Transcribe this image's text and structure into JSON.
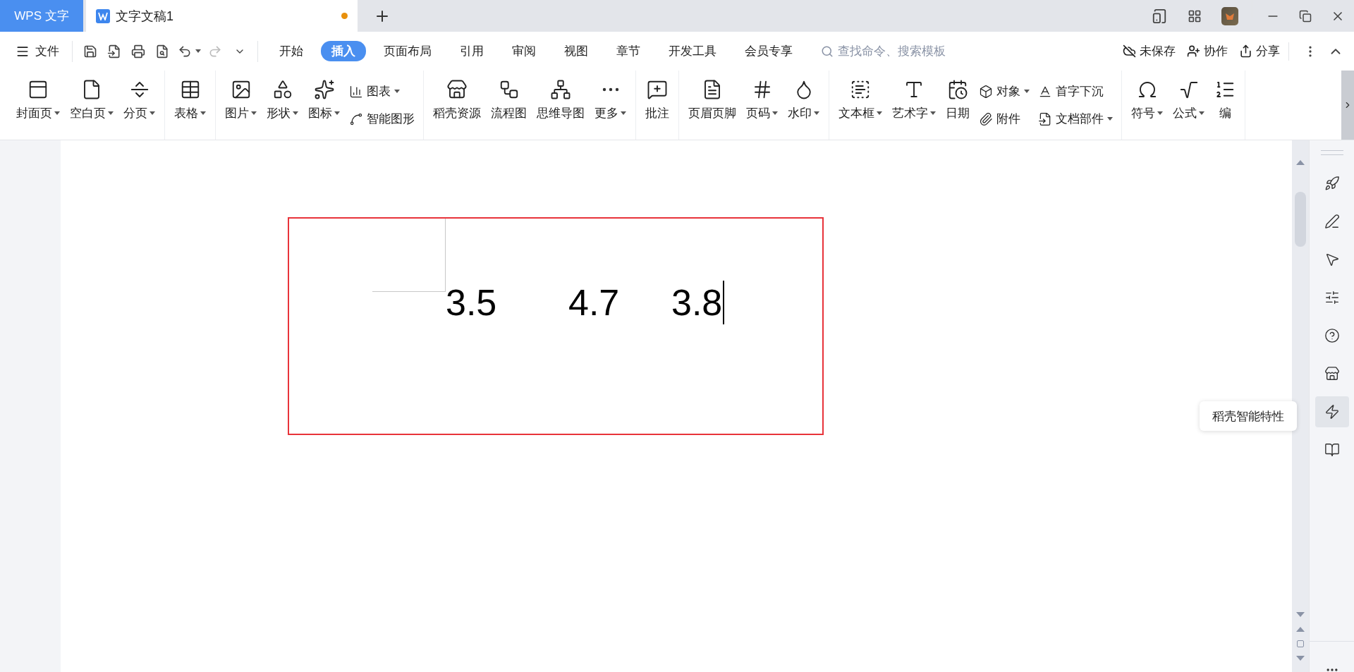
{
  "app_tab": "WPS 文字",
  "document_tab": {
    "title": "文字文稿1",
    "modified": true
  },
  "file_menu": "文件",
  "ribbon_tabs": [
    {
      "label": "开始",
      "selected": false
    },
    {
      "label": "插入",
      "selected": true
    },
    {
      "label": "页面布局",
      "selected": false
    },
    {
      "label": "引用",
      "selected": false
    },
    {
      "label": "审阅",
      "selected": false
    },
    {
      "label": "视图",
      "selected": false
    },
    {
      "label": "章节",
      "selected": false
    },
    {
      "label": "开发工具",
      "selected": false
    },
    {
      "label": "会员专享",
      "selected": false
    }
  ],
  "search": {
    "placeholder": "查找命令、搜索模板"
  },
  "actions": [
    "未保存",
    "协作",
    "分享"
  ],
  "ribbon_groups": [
    {
      "items": [
        {
          "kind": "large",
          "label": "封面页",
          "dropdown": true
        },
        {
          "kind": "large",
          "label": "空白页",
          "dropdown": true
        },
        {
          "kind": "large",
          "label": "分页",
          "dropdown": true
        }
      ]
    },
    {
      "items": [
        {
          "kind": "large",
          "label": "表格",
          "dropdown": true
        }
      ]
    },
    {
      "items": [
        {
          "kind": "large",
          "label": "图片",
          "dropdown": true
        },
        {
          "kind": "large",
          "label": "形状",
          "dropdown": true
        },
        {
          "kind": "large",
          "label": "图标",
          "dropdown": true
        },
        {
          "kind": "stack",
          "entries": [
            {
              "label": "图表",
              "dropdown": true
            },
            {
              "label": "智能图形",
              "dropdown": false
            }
          ]
        }
      ]
    },
    {
      "items": [
        {
          "kind": "large",
          "label": "稻壳资源",
          "dropdown": false
        },
        {
          "kind": "large",
          "label": "流程图",
          "dropdown": false
        },
        {
          "kind": "large",
          "label": "思维导图",
          "dropdown": false
        },
        {
          "kind": "large",
          "label": "更多",
          "dropdown": true
        }
      ]
    },
    {
      "items": [
        {
          "kind": "large",
          "label": "批注",
          "dropdown": false
        }
      ]
    },
    {
      "items": [
        {
          "kind": "large",
          "label": "页眉页脚",
          "dropdown": false
        },
        {
          "kind": "large",
          "label": "页码",
          "dropdown": true
        },
        {
          "kind": "large",
          "label": "水印",
          "dropdown": true
        }
      ]
    },
    {
      "items": [
        {
          "kind": "large",
          "label": "文本框",
          "dropdown": true
        },
        {
          "kind": "large",
          "label": "艺术字",
          "dropdown": true
        },
        {
          "kind": "large",
          "label": "日期",
          "dropdown": false
        },
        {
          "kind": "stack",
          "entries": [
            {
              "label": "对象",
              "dropdown": true
            },
            {
              "label": "附件",
              "dropdown": false
            }
          ]
        },
        {
          "kind": "stack",
          "entries": [
            {
              "label": "首字下沉",
              "dropdown": false
            },
            {
              "label": "文档部件",
              "dropdown": true
            }
          ]
        }
      ]
    },
    {
      "items": [
        {
          "kind": "large",
          "label": "符号",
          "dropdown": true
        },
        {
          "kind": "large",
          "label": "公式",
          "dropdown": true
        },
        {
          "kind": "large",
          "label": "编",
          "dropdown": false
        }
      ]
    }
  ],
  "text_box": {
    "values": [
      "3.5",
      "4.7",
      "3.8"
    ]
  },
  "sidebar_items": [
    {
      "selected": false
    },
    {
      "selected": false
    },
    {
      "selected": false
    },
    {
      "selected": false
    },
    {
      "selected": false
    },
    {
      "selected": false
    },
    {
      "selected": true
    },
    {
      "selected": false
    }
  ],
  "tooltip": "稻壳智能特性"
}
